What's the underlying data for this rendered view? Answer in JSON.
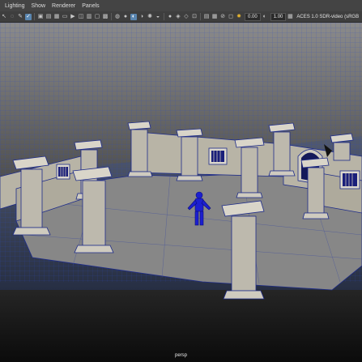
{
  "menubar": {
    "items": [
      {
        "label": "Lighting"
      },
      {
        "label": "Show"
      },
      {
        "label": "Renderer"
      },
      {
        "label": "Panels"
      }
    ]
  },
  "toolbar": {
    "icons": [
      "select-icon",
      "lasso-icon",
      "paint-icon",
      "bookmark-icon",
      "camera-attr-icon",
      "image-plane-icon",
      "grid-icon",
      "film-gate-icon",
      "resolution-gate-icon",
      "gate-mask-icon",
      "field-chart-icon",
      "safe-action-icon",
      "safe-title-icon",
      "wireframe-icon",
      "smooth-shade-icon",
      "default-light-icon",
      "textured-icon",
      "all-lights-icon",
      "shadows-icon",
      "xray-icon",
      "xray-joints-icon",
      "xray-components-icon",
      "isolate-icon",
      "motion-blur-icon",
      "ambient-occlusion-icon",
      "anti-alias-icon",
      "depth-of-field-icon",
      "exposure-icon",
      "gamma-icon",
      "colorspace-icon"
    ],
    "exposure_value": "0.00",
    "gamma_value": "1.00",
    "color_management": "ACES 1.0 SDR-video (sRGB"
  },
  "viewport": {
    "camera_label": "persp",
    "colors": {
      "background_top": "#8b8b8b",
      "background_bottom": "#0b0b0b",
      "grid_line": "#2b49c4",
      "floor_fill": "#878787",
      "wall_fill": "#b8b4a6",
      "character": "#1c1fd0"
    }
  }
}
